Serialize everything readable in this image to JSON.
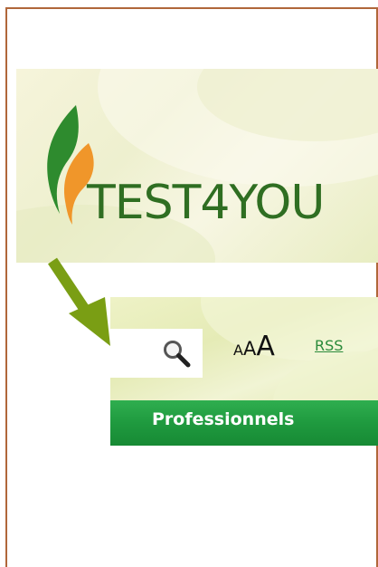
{
  "logo": {
    "text": "TEST4YOU",
    "icon": "flame-leaf-icon",
    "colors": {
      "text": "#2f6e22",
      "leaf_green": "#2e8b2e",
      "leaf_orange": "#f0962a"
    }
  },
  "annotation": {
    "icon": "arrow-down-right-icon",
    "color": "#7a9e14"
  },
  "toolbar": {
    "search": {
      "icon": "search-icon",
      "value": "",
      "placeholder": ""
    },
    "text_size": {
      "small": "A",
      "medium": "A",
      "large": "A"
    },
    "rss_label": "RSS"
  },
  "nav": {
    "professionnels_label": "Professionnels",
    "color": "#1f9a3f"
  },
  "frame": {
    "border_color": "#b0673a"
  }
}
